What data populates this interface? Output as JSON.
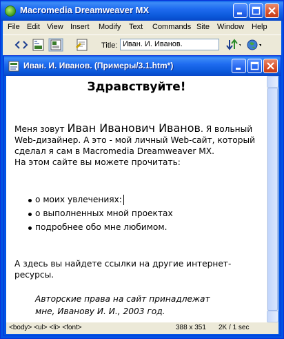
{
  "app": {
    "title": "Macromedia Dreamweaver MX"
  },
  "menu": [
    "File",
    "Edit",
    "View",
    "Insert",
    "Modify",
    "Text",
    "Commands",
    "Site",
    "Window",
    "Help"
  ],
  "toolbar": {
    "title_label": "Title:",
    "title_value": "Иван. И. Иванов."
  },
  "document": {
    "window_title": "Иван. И. Иванов. (Примеры/3.1.htm*)",
    "heading": "Здравствуйте!",
    "intro_prefix": "Меня зовут ",
    "name": "Иван Иванович Иванов",
    "intro_suffix": ". Я вольный Web-дизайнер. А это - мой личный Web-сайт, который сделал я сам в Macromedia Dreamweaver MX.",
    "intro_line2": "На этом сайте вы можете прочитать:",
    "bullets": [
      "о моих увлечениях:",
      "о выполненных мной проектах",
      "подробнее обо мне любимом."
    ],
    "links_text": "А здесь вы найдете ссылки на другие интернет-ресурсы.",
    "copyright_line1": "Авторские права на сайт принадлежат",
    "copyright_line2": "мне, Иванову И. И., 2003 год."
  },
  "status": {
    "tags": "<body> <ul> <li> <font>",
    "size": "388 x 351",
    "weight": "2K / 1 sec"
  },
  "icons": [
    "app-icon",
    "minimize-icon",
    "maximize-icon",
    "close-icon",
    "code-view-icon",
    "split-view-icon",
    "design-view-icon",
    "validate-icon",
    "file-management-icon",
    "preview-globe-icon",
    "document-icon"
  ]
}
